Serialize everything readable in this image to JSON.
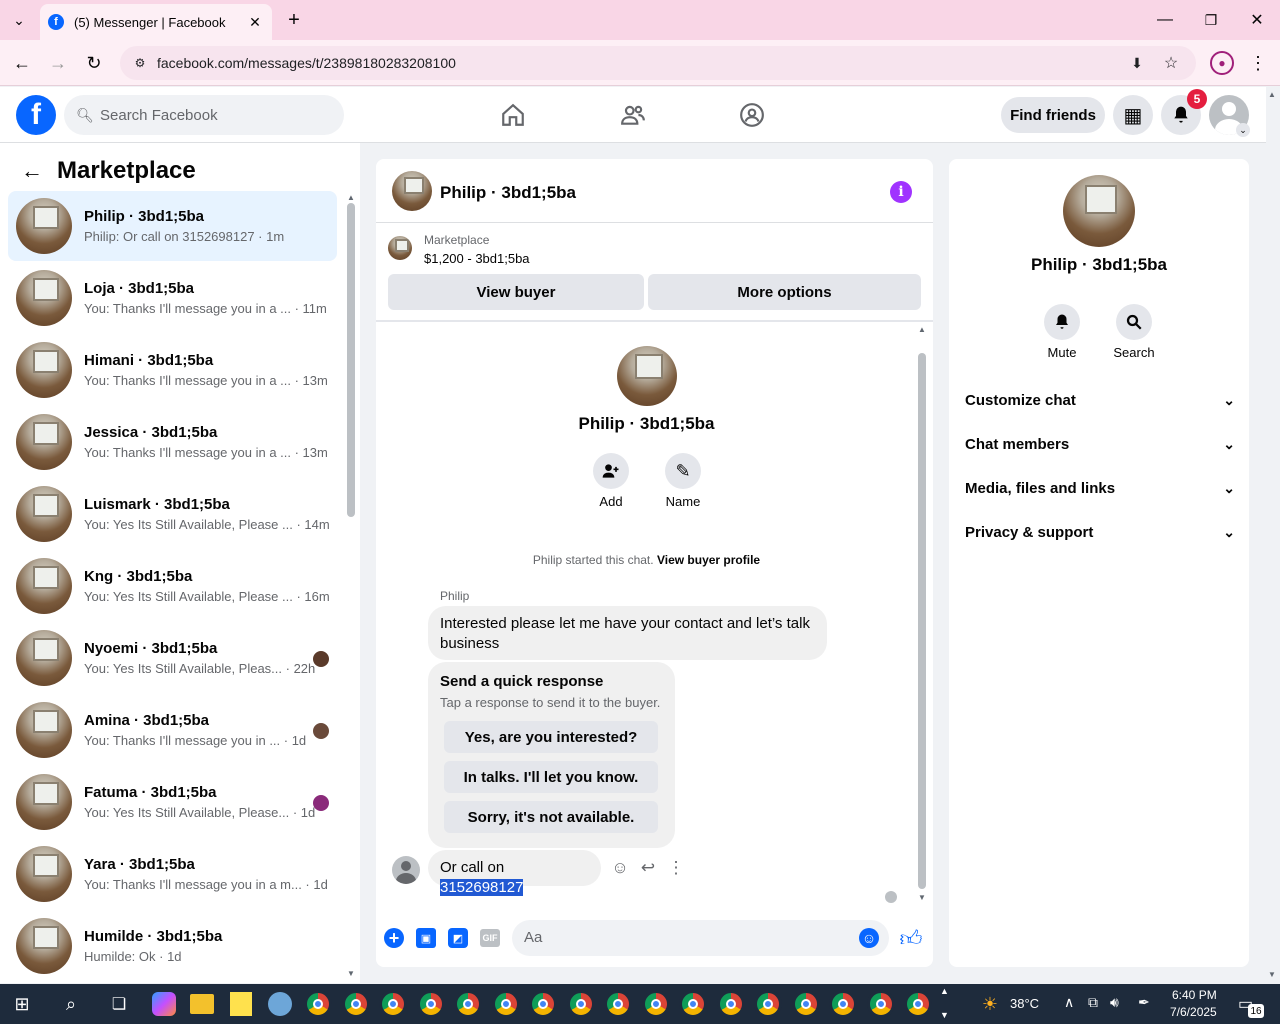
{
  "browser": {
    "tab_title": "(5) Messenger | Facebook",
    "url": "facebook.com/messages/t/23898180283208100"
  },
  "header": {
    "search_placeholder": "Search Facebook",
    "find_friends": "Find friends",
    "notif_count": "5"
  },
  "sidebar": {
    "title": "Marketplace",
    "conversations": [
      {
        "name": "Philip · 3bd1;5ba",
        "preview": "Philip: Or call on 3152698127 · 1m",
        "active": true
      },
      {
        "name": "Loja · 3bd1;5ba",
        "preview": "You: Thanks I'll message you in a ... · 11m"
      },
      {
        "name": "Himani · 3bd1;5ba",
        "preview": "You: Thanks I'll message you in a ... · 13m"
      },
      {
        "name": "Jessica · 3bd1;5ba",
        "preview": "You: Thanks I'll message you in a ... · 13m"
      },
      {
        "name": "Luismark · 3bd1;5ba",
        "preview": "You: Yes Its Still Available, Please ... · 14m"
      },
      {
        "name": "Kng · 3bd1;5ba",
        "preview": "You: Yes Its Still Available, Please ... · 16m"
      },
      {
        "name": "Nyoemi · 3bd1;5ba",
        "preview": "You: Yes Its Still Available, Pleas... · 22h"
      },
      {
        "name": "Amina · 3bd1;5ba",
        "preview": "You: Thanks I'll message you in ... · 1d"
      },
      {
        "name": "Fatuma · 3bd1;5ba",
        "preview": "You: Yes Its Still Available, Please... · 1d"
      },
      {
        "name": "Yara · 3bd1;5ba",
        "preview": "You: Thanks I'll message you in a m... · 1d"
      },
      {
        "name": "Humilde · 3bd1;5ba",
        "preview": "Humilde: Ok · 1d"
      }
    ]
  },
  "chat": {
    "title": "Philip · 3bd1;5ba",
    "listing_label": "Marketplace",
    "listing_price": "$1,200 - 3bd1;5ba",
    "view_buyer": "View buyer",
    "more_options": "More options",
    "profile_name": "Philip · 3bd1;5ba",
    "add_label": "Add",
    "name_label": "Name",
    "started_text": "Philip started this chat.",
    "view_profile": "View buyer profile",
    "sender": "Philip",
    "message1": "Interested please let me have your contact and let’s talk business",
    "quick_title": "Send a quick response",
    "quick_sub": "Tap a response to send it to the buyer.",
    "quick_responses": [
      "Yes, are you interested?",
      "In talks. I'll let you know.",
      "Sorry, it's not available."
    ],
    "message2_prefix": "Or call on ",
    "message2_number": "3152698127",
    "composer_placeholder": "Aa"
  },
  "details": {
    "name": "Philip · 3bd1;5ba",
    "mute": "Mute",
    "search": "Search",
    "sections": [
      "Customize chat",
      "Chat members",
      "Media, files and links",
      "Privacy & support"
    ]
  },
  "taskbar": {
    "temperature": "38°C",
    "time": "6:40 PM",
    "date": "7/6/2025",
    "notif": "16"
  },
  "colors": {
    "fb_blue": "#0866ff",
    "purple": "#a033ff",
    "notif_red": "#e41e3f"
  }
}
